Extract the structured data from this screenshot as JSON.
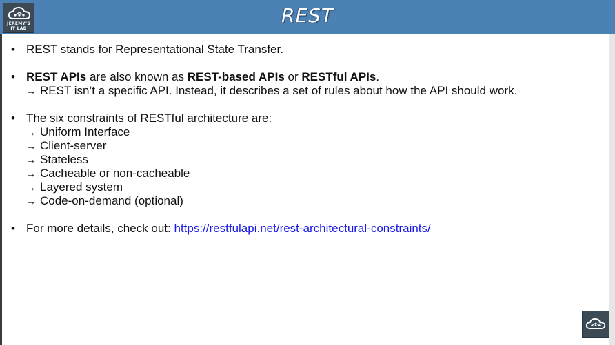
{
  "slide": {
    "title": "REST",
    "logo_line1": "JEREMY'S",
    "logo_line2": "IT LAB"
  },
  "content": {
    "b1": "REST stands for Representational State Transfer.",
    "b2_part1": "REST APIs",
    "b2_part2": " are also known as ",
    "b2_part3": "REST-based APIs",
    "b2_part4": " or ",
    "b2_part5": "RESTful APIs",
    "b2_part6": ".",
    "b2_sub": "REST isn’t a specific API.  Instead, it describes a set of rules about how the API should work.",
    "b3": "The six constraints of RESTful architecture are:",
    "constraints": [
      "Uniform Interface",
      "Client-server",
      "Stateless",
      "Cacheable or non-cacheable",
      "Layered system",
      "Code-on-demand (optional)"
    ],
    "b4_text": "For more details, check out: ",
    "b4_link": "https://restfulapi.net/rest-architectural-constraints/",
    "arrow": "→"
  },
  "colors": {
    "header": "#4b81b4",
    "link": "#1a1ae6"
  },
  "icons": [
    "cloud-logo-icon"
  ]
}
